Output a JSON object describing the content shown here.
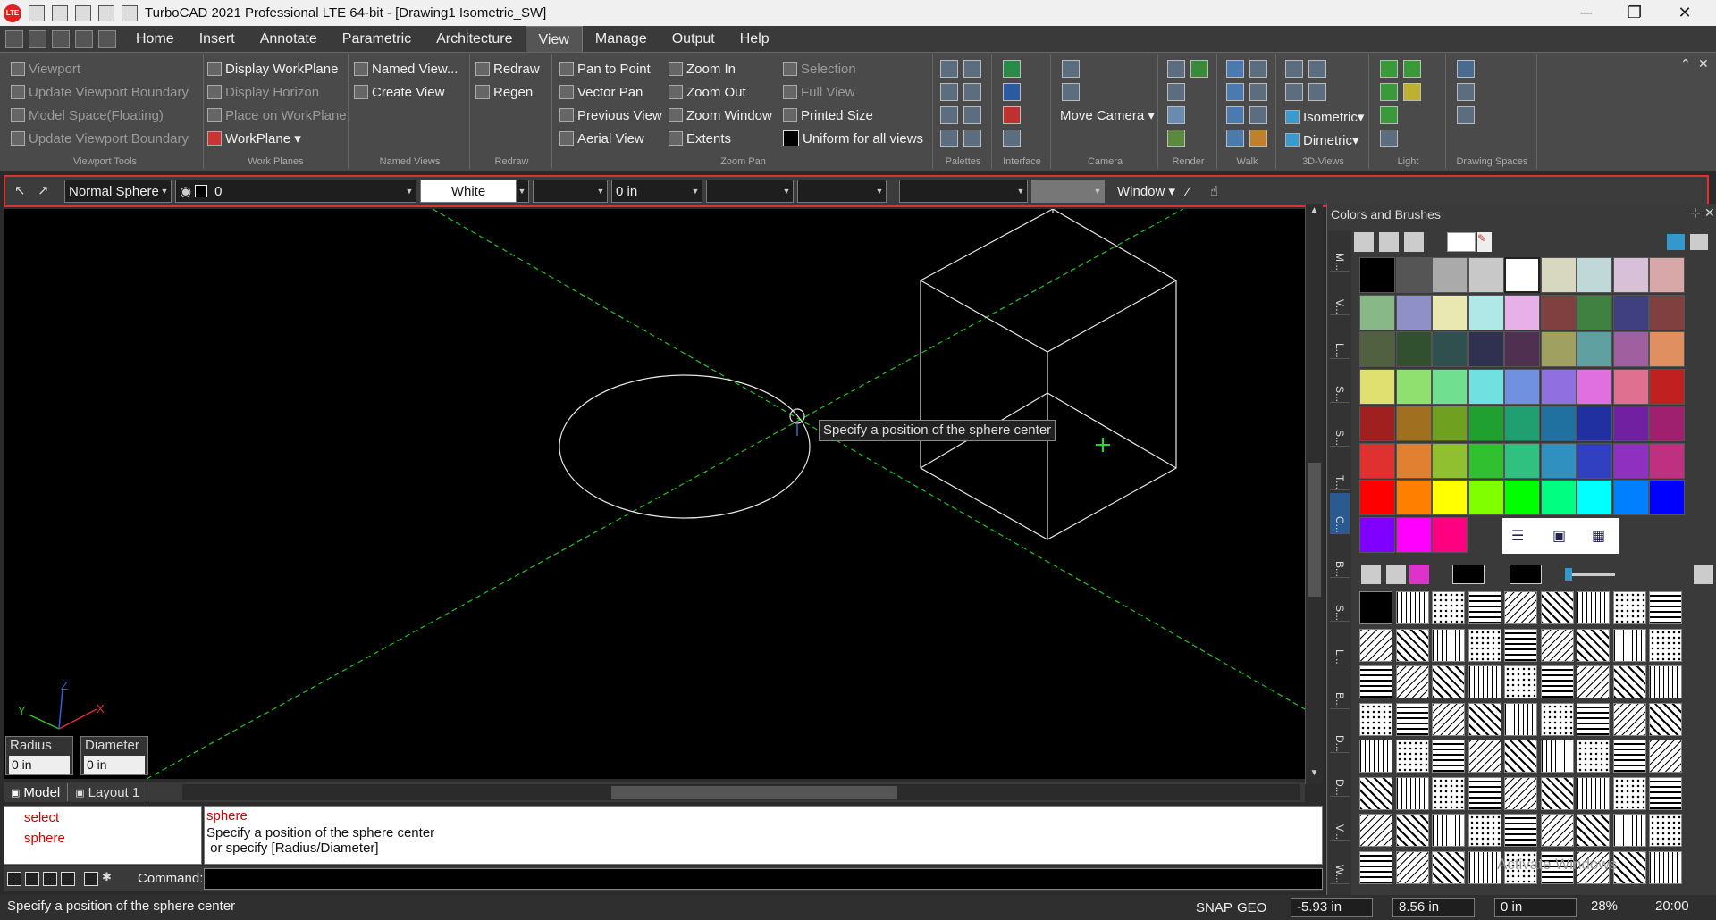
{
  "title_bar": {
    "title": "TurboCAD 2021 Professional LTE 64-bit - [Drawing1 Isometric_SW]",
    "logo": "LTE",
    "minimize": "─",
    "maximize": "❐",
    "close": "✕"
  },
  "menu": {
    "tabs": [
      "Home",
      "Insert",
      "Annotate",
      "Parametric",
      "Architecture",
      "View",
      "Manage",
      "Output",
      "Help"
    ],
    "active_tab": "View"
  },
  "ribbon": {
    "viewport_tools": {
      "label": "Viewport Tools",
      "items": [
        "Viewport",
        "Update Viewport Boundary",
        "Model Space(Floating)",
        "Update Viewport Boundary"
      ]
    },
    "work_planes": {
      "label": "Work Planes",
      "items": [
        "Display WorkPlane",
        "Display Horizon",
        "Place on WorkPlane",
        "WorkPlane"
      ]
    },
    "named_views": {
      "label": "Named Views",
      "items": [
        "Named View...",
        "Create View"
      ]
    },
    "redraw": {
      "label": "Redraw",
      "items": [
        "Redraw",
        "Regen"
      ]
    },
    "zoom_pan": {
      "label": "Zoom Pan",
      "col1": [
        "Pan to Point",
        "Vector Pan",
        "Previous View",
        "Aerial View"
      ],
      "col2": [
        "Zoom In",
        "Zoom Out",
        "Zoom Window",
        "Extents"
      ],
      "col3": [
        "Selection",
        "Full View",
        "Printed Size",
        "Uniform for all views"
      ]
    },
    "palettes": {
      "label": "Palettes"
    },
    "interface": {
      "label": "Interface"
    },
    "camera": {
      "label": "Camera",
      "items": [
        "Move Camera"
      ]
    },
    "render": {
      "label": "Render"
    },
    "walk": {
      "label": "Walk"
    },
    "views_3d": {
      "label": "3D-Views",
      "items": [
        "Isometric",
        "Dimetric"
      ]
    },
    "light": {
      "label": "Light"
    },
    "drawing_spaces": {
      "label": "Drawing Spaces"
    }
  },
  "property_toolbar": {
    "style": "Normal Sphere",
    "layer": "0",
    "color": "White",
    "width": "0 in",
    "window": "Window"
  },
  "canvas": {
    "tooltip": "Specify a position of the sphere center",
    "axis_labels": {
      "x": "X",
      "y": "Y",
      "z": "Z"
    },
    "radius_label": "Radius",
    "radius_value": "0 in",
    "diameter_label": "Diameter",
    "diameter_value": "0 in"
  },
  "layout_tabs": [
    "Model",
    "Layout 1"
  ],
  "command": {
    "history": [
      "select",
      "sphere"
    ],
    "output": [
      "sphere",
      "Specify a position of the sphere center",
      " or specify [Radius/Diameter]"
    ],
    "prompt_label": "Command:"
  },
  "status_bar": {
    "message": "Specify a position of the sphere center",
    "snap": "SNAP",
    "geo": "GEO",
    "x_value": "-5.93 in",
    "y_value": "8.56 in",
    "z_value": "0 in",
    "zoom": "28%",
    "time": "20:00"
  },
  "palette": {
    "title": "Colors and Brushes",
    "vtabs": [
      "M...",
      "V...",
      "L...",
      "S...",
      "S...",
      "T...",
      "C...",
      "B...",
      "S...",
      "L...",
      "B...",
      "D...",
      "D...",
      "V...",
      "W..."
    ],
    "colors": [
      "#000000",
      "#555555",
      "#aaaaaa",
      "#c8c8c8",
      "#ffffff",
      "#d8d8c0",
      "#c0d8d8",
      "#d8c0d8",
      "#d8a8a8",
      "#88b888",
      "#9090c8",
      "#e8e8b0",
      "#b0e8e8",
      "#e8b0e8",
      "#804040",
      "#408040",
      "#404080",
      "#804040",
      "#506040",
      "#305030",
      "#305050",
      "#303050",
      "#503050",
      "#a0a060",
      "#60a0a0",
      "#a060a0",
      "#e09060",
      "#e0e070",
      "#90e070",
      "#70e090",
      "#70e0e0",
      "#7090e0",
      "#9070e0",
      "#e070e0",
      "#e07090",
      "#c02020",
      "#a02020",
      "#a07020",
      "#70a020",
      "#20a030",
      "#20a070",
      "#2070a0",
      "#2030a0",
      "#7020a0",
      "#a02070",
      "#e03030",
      "#e08030",
      "#90c030",
      "#30c030",
      "#30c080",
      "#3090c0",
      "#3040c0",
      "#9030c0",
      "#c03080",
      "#ff0000",
      "#ff8000",
      "#ffff00",
      "#80ff00",
      "#00ff00",
      "#00ff80",
      "#00ffff",
      "#0080ff",
      "#0000ff",
      "#8000ff",
      "#ff00ff",
      "#ff0080"
    ],
    "watermark": "Activate Windows"
  }
}
